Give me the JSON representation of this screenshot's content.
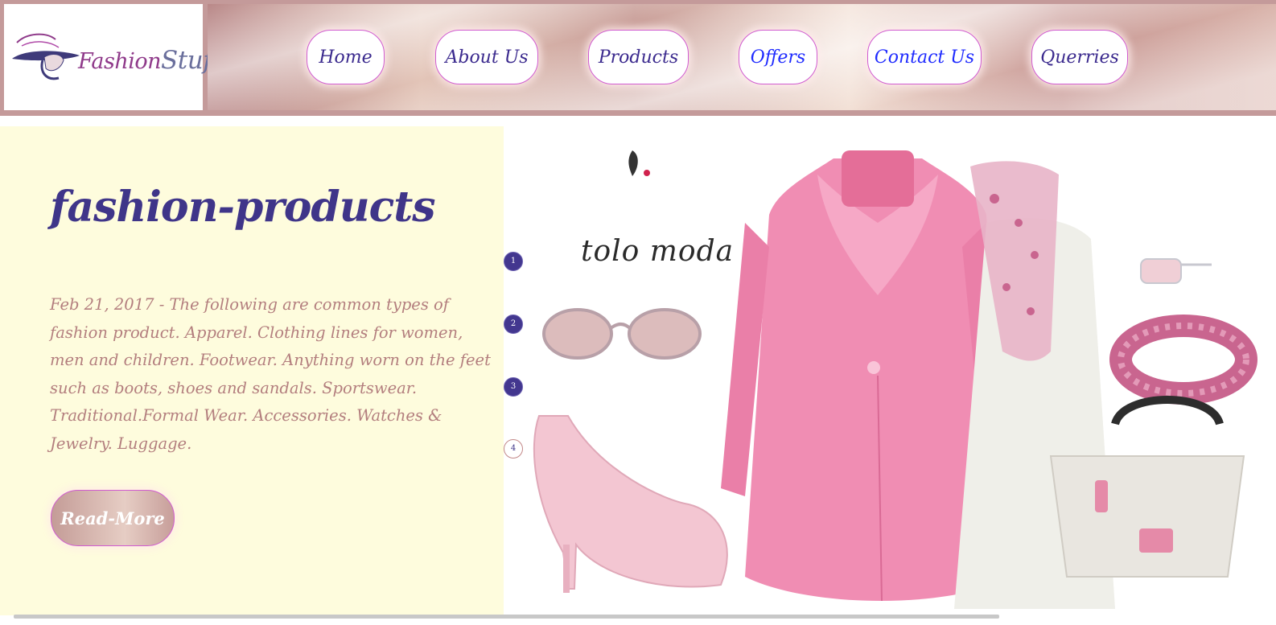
{
  "logo": {
    "text_fashion": "Fashion",
    "text_stuff": "Stuff"
  },
  "nav": {
    "items": [
      {
        "label": "Home"
      },
      {
        "label": "About Us"
      },
      {
        "label": "Products"
      },
      {
        "label": "Offers"
      },
      {
        "label": "Contact Us"
      },
      {
        "label": "Querries"
      }
    ]
  },
  "hero": {
    "title": "fashion-products",
    "description": "Feb 21, 2017 - The following are common types of fashion product. Apparel. Clothing lines for women, men and children. Footwear. Anything worn on the feet such as boots, shoes and sandals. Sportswear. Traditional.Formal Wear. Accessories. Watches & Jewelry. Luggage.",
    "read_more_label": "Read-More"
  },
  "slider": {
    "brand_caption": "tolo moda",
    "dots": [
      "1",
      "2",
      "3",
      "4"
    ],
    "active_index": 0
  },
  "colors": {
    "header_bg": "#c49a9a",
    "hero_left_bg": "#fefcdd",
    "title_color": "#3f3589",
    "desc_color": "#b37e7e",
    "nav_border": "#d05bd0",
    "coat_pink": "#f08db3"
  }
}
